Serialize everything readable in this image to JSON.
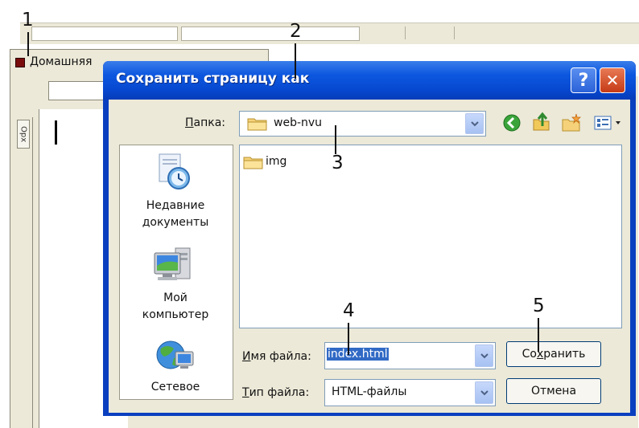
{
  "background_app": {
    "tab_label": "Домашняя",
    "ruler_label": "Орх"
  },
  "annotations": [
    "1",
    "2",
    "3",
    "4",
    "5"
  ],
  "dialog": {
    "title": "Сохранить страницу как",
    "help_symbol": "?",
    "close_symbol": "✕",
    "folder_label": {
      "accel": "П",
      "rest": "апка:"
    },
    "folder_value": "web-nvu",
    "places": [
      {
        "label_line1": "Недавние",
        "label_line2": "документы",
        "icon": "recent-documents-icon"
      },
      {
        "label_line1": "Мой",
        "label_line2": "компьютер",
        "icon": "my-computer-icon"
      },
      {
        "label_line1": "Сетевое",
        "label_line2": "",
        "icon": "network-icon"
      }
    ],
    "files": [
      {
        "name": "img",
        "icon": "folder-icon"
      }
    ],
    "filename_label": {
      "accel": "И",
      "rest": "мя файла:"
    },
    "filename_value": "index.html",
    "filetype_label": {
      "accel": "Т",
      "rest": "ип файла:"
    },
    "filetype_value": "HTML-файлы",
    "save_button": {
      "pre": "Со",
      "accel": "х",
      "post": "ранить"
    },
    "cancel_button": "Отмена",
    "colors": {
      "title_bar": "#0a58e0",
      "face": "#ece9d8",
      "selection": "#316ac5"
    }
  }
}
